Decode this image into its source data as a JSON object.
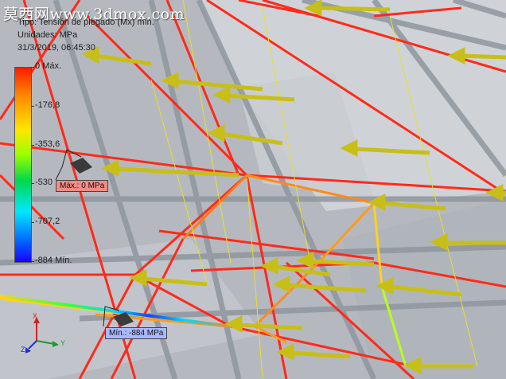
{
  "watermark": "莫西网www.3dmox.com",
  "result_info": {
    "type_line": "Tipo: Tensión de plegado (Mx) mín.",
    "units_line": "Unidades: MPa",
    "datetime_line": "31/3/2019, 06:45:30"
  },
  "legend": {
    "max_label": "0 Máx.",
    "ticks": [
      "-176,8",
      "-353,6",
      "-530",
      "-707,2"
    ],
    "min_label": "-884 Mín."
  },
  "probes": {
    "max": "Máx.: 0 MPa",
    "min": "Mín.: -884 MPa"
  },
  "triad": {
    "x": "X",
    "y": "Y",
    "z": "Z"
  },
  "colors": {
    "hot": "#ff2a1a",
    "mid": "#ffd21a",
    "cold": "#1a40ff",
    "load_arrow": "#c7bf18",
    "frame": "#8f969e"
  }
}
